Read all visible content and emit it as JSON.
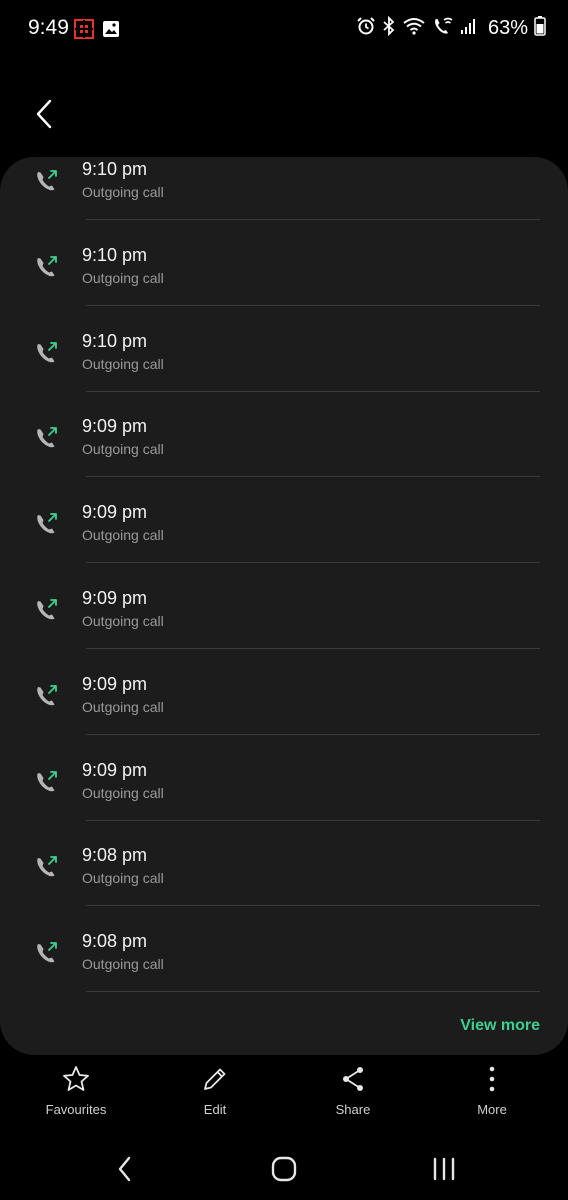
{
  "status_bar": {
    "time": "9:49",
    "left_icons": [
      "app-notification-icon",
      "gallery-icon"
    ],
    "right_icons": [
      "alarm-icon",
      "bluetooth-icon",
      "wifi-icon",
      "wifi-calling-icon",
      "signal-icon"
    ],
    "battery": "63%"
  },
  "header": {
    "back_icon": "back-arrow-icon"
  },
  "calls": [
    {
      "time": "9:10 pm",
      "type": "Outgoing call"
    },
    {
      "time": "9:10 pm",
      "type": "Outgoing call"
    },
    {
      "time": "9:10 pm",
      "type": "Outgoing call"
    },
    {
      "time": "9:09 pm",
      "type": "Outgoing call"
    },
    {
      "time": "9:09 pm",
      "type": "Outgoing call"
    },
    {
      "time": "9:09 pm",
      "type": "Outgoing call"
    },
    {
      "time": "9:09 pm",
      "type": "Outgoing call"
    },
    {
      "time": "9:09 pm",
      "type": "Outgoing call"
    },
    {
      "time": "9:08 pm",
      "type": "Outgoing call"
    },
    {
      "time": "9:08 pm",
      "type": "Outgoing call"
    }
  ],
  "view_more": "View more",
  "toolbar": {
    "favourites": "Favourites",
    "edit": "Edit",
    "share": "Share",
    "more": "More"
  },
  "colors": {
    "accent": "#3ecf8e",
    "card_bg": "#1c1c1c",
    "outgoing_arrow": "#3ecf8e"
  }
}
